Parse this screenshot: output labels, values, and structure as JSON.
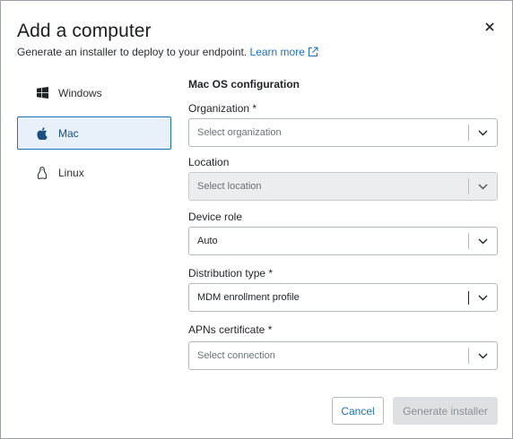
{
  "dialog": {
    "title": "Add a computer",
    "subtitle": "Generate an installer to deploy to your endpoint.",
    "learn_more": "Learn more",
    "close_icon": "close-icon"
  },
  "sidebar": {
    "items": [
      {
        "label": "Windows",
        "icon": "windows-icon",
        "selected": false
      },
      {
        "label": "Mac",
        "icon": "apple-icon",
        "selected": true
      },
      {
        "label": "Linux",
        "icon": "linux-icon",
        "selected": false
      }
    ]
  },
  "form": {
    "section_title": "Mac OS configuration",
    "organization": {
      "label": "Organization *",
      "placeholder": "Select organization"
    },
    "location": {
      "label": "Location",
      "placeholder": "Select location",
      "disabled": true
    },
    "device_role": {
      "label": "Device role",
      "value": "Auto"
    },
    "distribution_type": {
      "label": "Distribution type *",
      "value": "MDM enrollment profile"
    },
    "apns_certificate": {
      "label": "APNs certificate *",
      "placeholder": "Select connection"
    }
  },
  "buttons": {
    "cancel": "Cancel",
    "generate": "Generate installer"
  },
  "colors": {
    "accent": "#1a73b8",
    "selected_bg": "#e8f1fa",
    "disabled_bg": "#ebedef"
  }
}
